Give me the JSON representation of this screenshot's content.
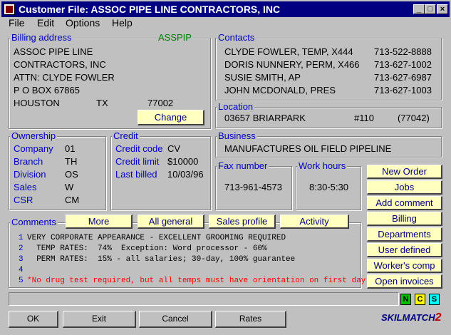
{
  "window": {
    "title": "Customer File:  ASSOC PIPE LINE CONTRACTORS, INC"
  },
  "menu": [
    "File",
    "Edit",
    "Options",
    "Help"
  ],
  "billing": {
    "label": "Billing address",
    "code": "ASSPIP",
    "lines": [
      "ASSOC PIPE LINE",
      "CONTRACTORS, INC",
      "ATTN: CLYDE FOWLER",
      "P O BOX 67865"
    ],
    "city": "HOUSTON",
    "state": "TX",
    "zip": "77002",
    "change_label": "Change"
  },
  "contacts": {
    "label": "Contacts",
    "items": [
      {
        "name": "CLYDE FOWLER, TEMP, X444",
        "phone": "713-522-8888"
      },
      {
        "name": "DORIS NUNNERY, PERM, X466",
        "phone": "713-627-1002"
      },
      {
        "name": "SUSIE SMITH, AP",
        "phone": "713-627-6987"
      },
      {
        "name": "JOHN MCDONALD, PRES",
        "phone": "713-627-1003"
      }
    ]
  },
  "location": {
    "label": "Location",
    "street": "03657 BRIARPARK",
    "suite": "#110",
    "zip": "(77042)"
  },
  "business": {
    "label": "Business",
    "value": "MANUFACTURES OIL FIELD PIPELINE"
  },
  "ownership": {
    "label": "Ownership",
    "rows": [
      {
        "k": "Company",
        "v": "01"
      },
      {
        "k": "Branch",
        "v": "TH"
      },
      {
        "k": "Division",
        "v": "OS"
      },
      {
        "k": "Sales",
        "v": "W"
      },
      {
        "k": "CSR",
        "v": "CM"
      }
    ]
  },
  "credit": {
    "label": "Credit",
    "rows": [
      {
        "k": "Credit code",
        "v": "CV"
      },
      {
        "k": "Credit limit",
        "v": "$10000"
      },
      {
        "k": "Last billed",
        "v": "10/03/96"
      }
    ]
  },
  "fax": {
    "label": "Fax number",
    "value": "713-961-4573"
  },
  "hours": {
    "label": "Work hours",
    "value": "8:30-5:30"
  },
  "side_buttons": [
    "New Order",
    "Jobs",
    "Add comment",
    "Billing",
    "Departments",
    "User defined",
    "Worker's comp",
    "Open invoices"
  ],
  "comments": {
    "label": "Comments",
    "buttons": [
      "More",
      "All general",
      "Sales profile",
      "Activity"
    ],
    "lines": [
      {
        "n": "1",
        "text": "VERY CORPORATE APPEARANCE - EXCELLENT GROOMING REQUIRED"
      },
      {
        "n": "2",
        "text": "  TEMP RATES:  74%  Exception: Word processor - 60%"
      },
      {
        "n": "3",
        "text": "  PERM RATES:  15% - all salaries; 30-day, 100% guarantee"
      },
      {
        "n": "4",
        "text": ""
      },
      {
        "n": "5",
        "text": "*No drug test required, but all temps must have orientation on first day"
      }
    ],
    "alert_color": "#ff0000"
  },
  "indicators": [
    "N",
    "C",
    "S"
  ],
  "bottom_buttons": [
    "OK",
    "Exit",
    "Cancel",
    "Rates"
  ],
  "brand": {
    "name": "SKILMATCH",
    "suffix": "2"
  }
}
